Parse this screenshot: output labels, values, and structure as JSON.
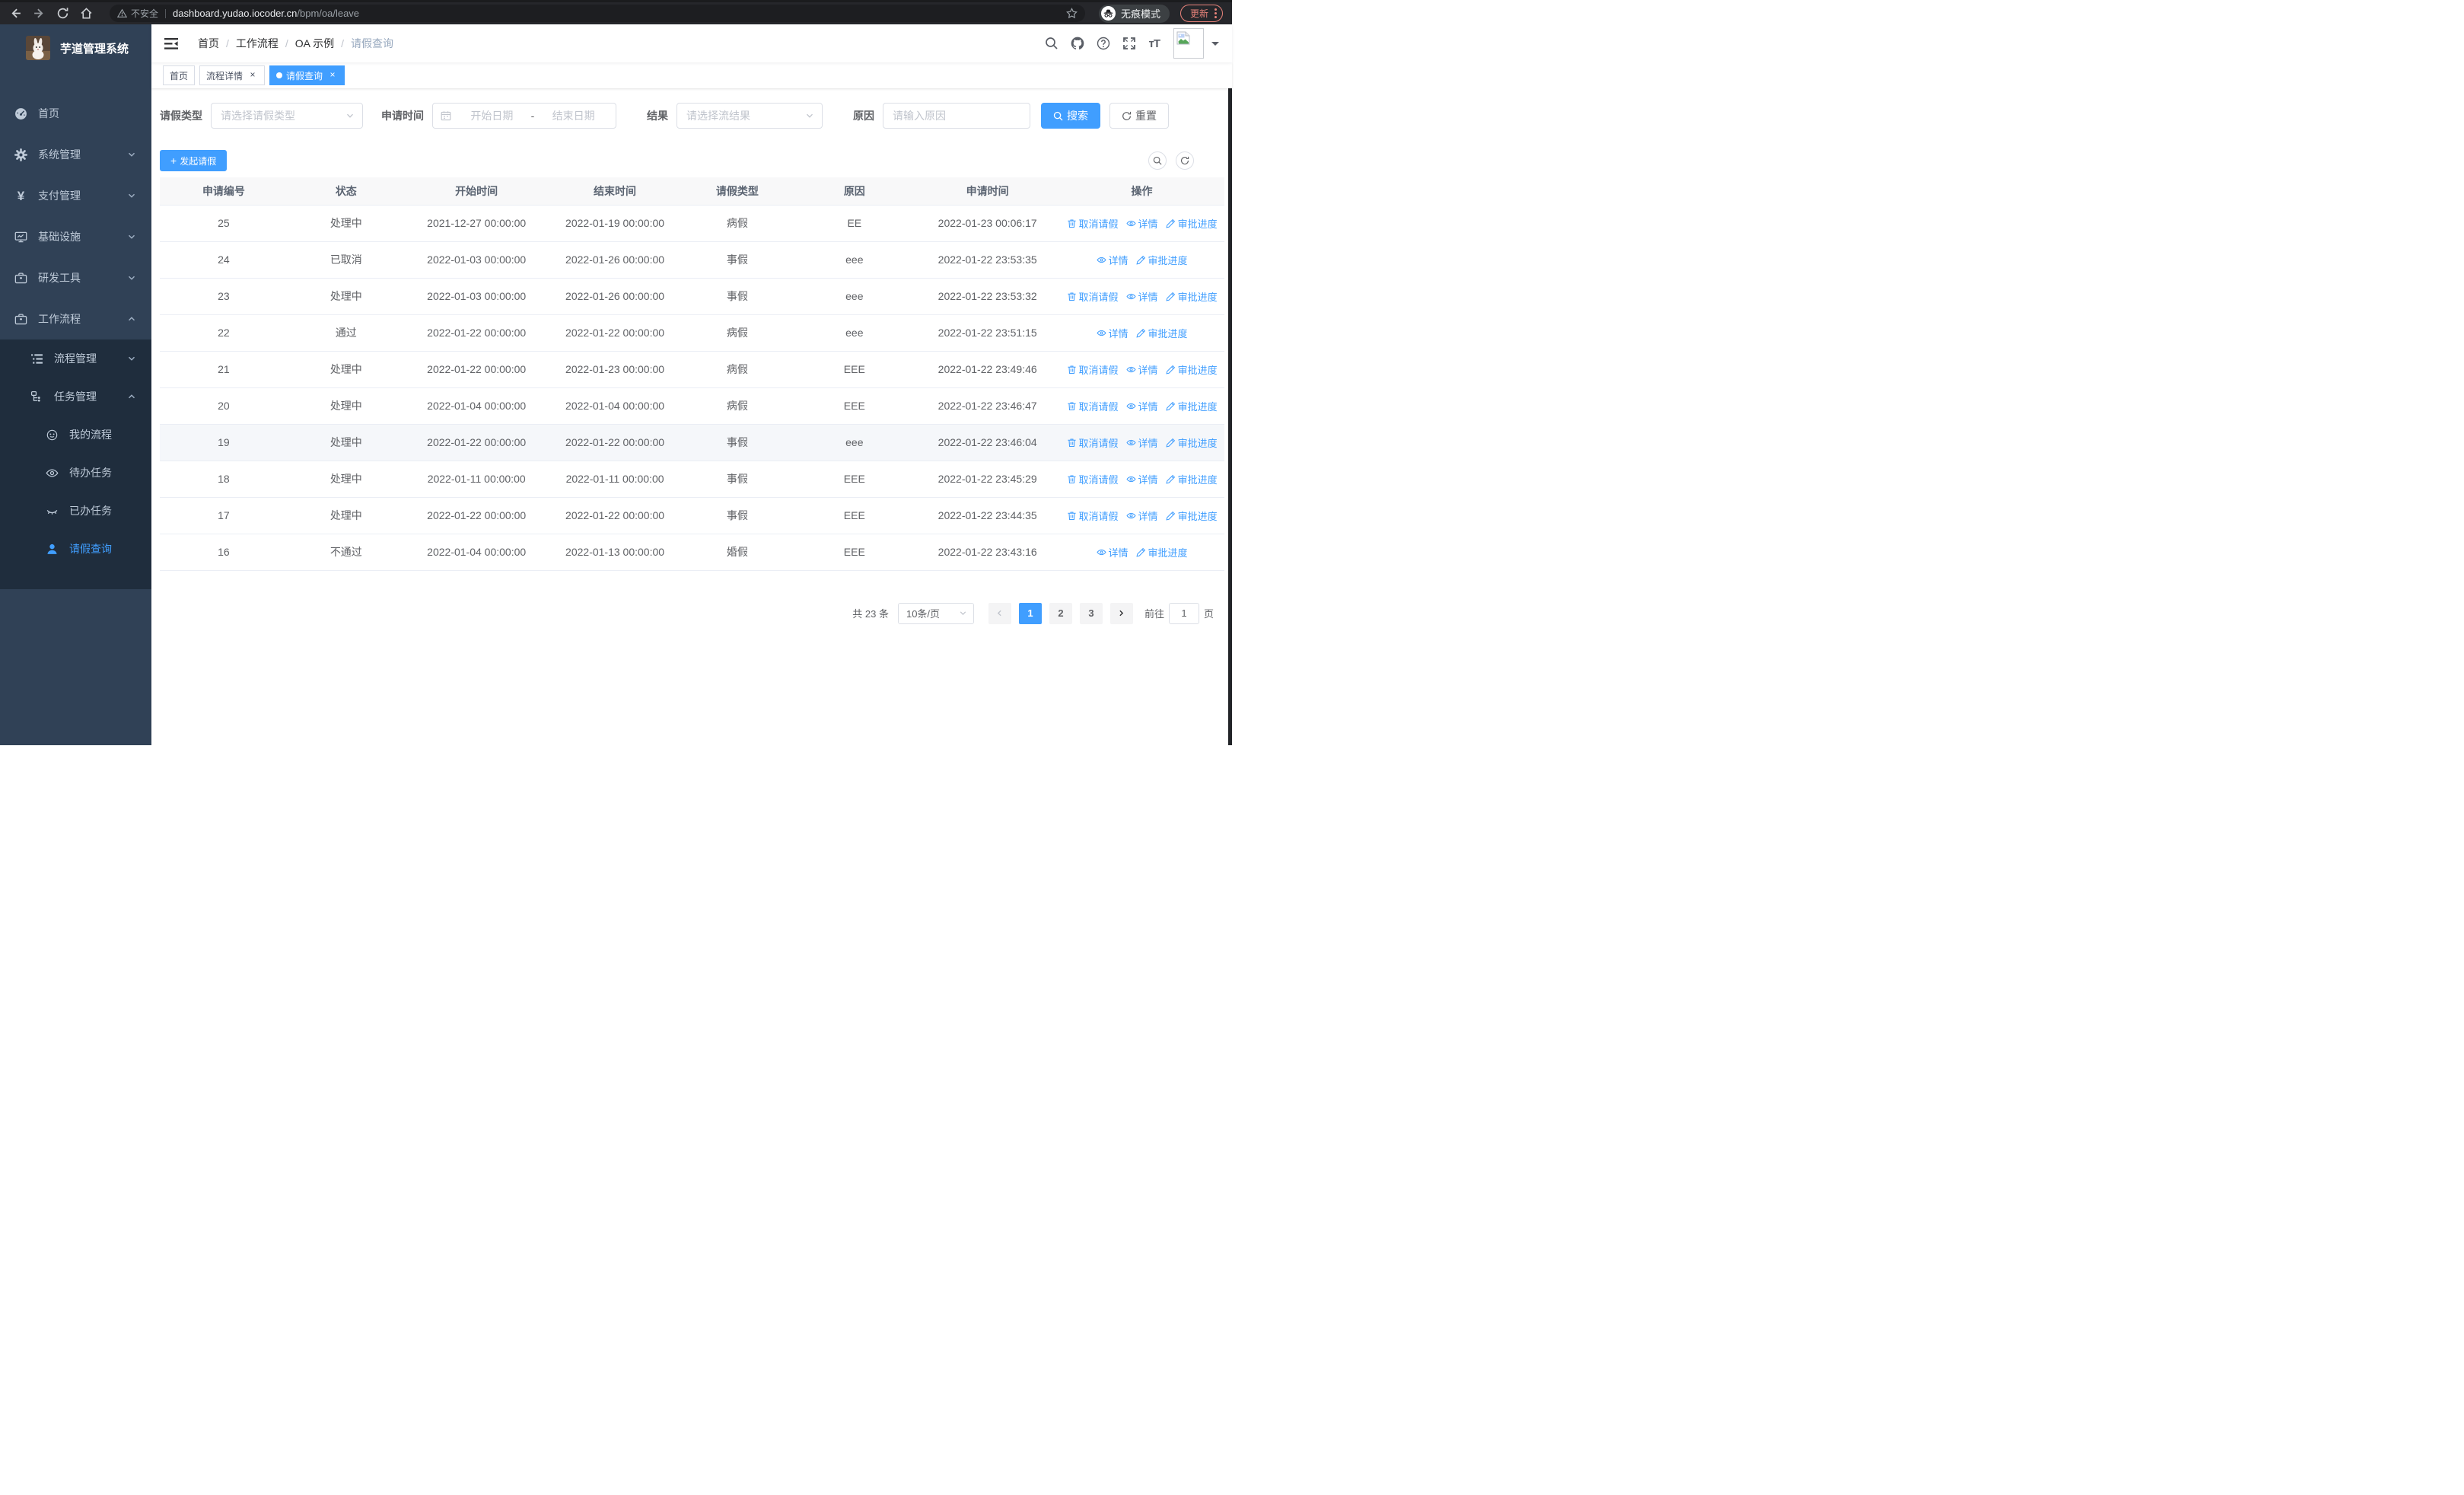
{
  "browser": {
    "security_label": "不安全",
    "url_domain": "dashboard.yudao.iocoder.cn",
    "url_path": "/bpm/oa/leave",
    "incognito_label": "无痕模式",
    "update_label": "更新"
  },
  "sidebar": {
    "logo_title": "芋道管理系统",
    "items": [
      {
        "label": "首页"
      },
      {
        "label": "系统管理"
      },
      {
        "label": "支付管理"
      },
      {
        "label": "基础设施"
      },
      {
        "label": "研发工具"
      },
      {
        "label": "工作流程"
      }
    ],
    "workflow_children": [
      {
        "label": "流程管理"
      },
      {
        "label": "任务管理"
      }
    ],
    "task_children": [
      {
        "label": "我的流程"
      },
      {
        "label": "待办任务"
      },
      {
        "label": "已办任务"
      },
      {
        "label": "请假查询"
      }
    ]
  },
  "navbar": {
    "breadcrumb": [
      "首页",
      "工作流程",
      "OA 示例",
      "请假查询"
    ]
  },
  "tabs": [
    {
      "label": "首页"
    },
    {
      "label": "流程详情"
    },
    {
      "label": "请假查询"
    }
  ],
  "filters": {
    "leave_type_label": "请假类型",
    "leave_type_placeholder": "请选择请假类型",
    "apply_time_label": "申请时间",
    "date_start_placeholder": "开始日期",
    "date_separator": "-",
    "date_end_placeholder": "结束日期",
    "result_label": "结果",
    "result_placeholder": "请选择流结果",
    "reason_label": "原因",
    "reason_placeholder": "请输入原因",
    "search_label": "搜索",
    "reset_label": "重置"
  },
  "toolbar": {
    "create_label": "发起请假"
  },
  "table": {
    "headers": [
      "申请编号",
      "状态",
      "开始时间",
      "结束时间",
      "请假类型",
      "原因",
      "申请时间",
      "操作"
    ],
    "action_labels": {
      "cancel": "取消请假",
      "detail": "详情",
      "progress": "审批进度"
    },
    "rows": [
      {
        "id": "25",
        "status": "处理中",
        "start_time": "2021-12-27 00:00:00",
        "end_time": "2022-01-19 00:00:00",
        "leave_type": "病假",
        "reason": "EE",
        "apply_time": "2022-01-23 00:06:17",
        "actions": [
          "cancel",
          "detail",
          "progress"
        ],
        "highlight": false
      },
      {
        "id": "24",
        "status": "已取消",
        "start_time": "2022-01-03 00:00:00",
        "end_time": "2022-01-26 00:00:00",
        "leave_type": "事假",
        "reason": "eee",
        "apply_time": "2022-01-22 23:53:35",
        "actions": [
          "detail",
          "progress"
        ],
        "highlight": false
      },
      {
        "id": "23",
        "status": "处理中",
        "start_time": "2022-01-03 00:00:00",
        "end_time": "2022-01-26 00:00:00",
        "leave_type": "事假",
        "reason": "eee",
        "apply_time": "2022-01-22 23:53:32",
        "actions": [
          "cancel",
          "detail",
          "progress"
        ],
        "highlight": false
      },
      {
        "id": "22",
        "status": "通过",
        "start_time": "2022-01-22 00:00:00",
        "end_time": "2022-01-22 00:00:00",
        "leave_type": "病假",
        "reason": "eee",
        "apply_time": "2022-01-22 23:51:15",
        "actions": [
          "detail",
          "progress"
        ],
        "highlight": false
      },
      {
        "id": "21",
        "status": "处理中",
        "start_time": "2022-01-22 00:00:00",
        "end_time": "2022-01-23 00:00:00",
        "leave_type": "病假",
        "reason": "EEE",
        "apply_time": "2022-01-22 23:49:46",
        "actions": [
          "cancel",
          "detail",
          "progress"
        ],
        "highlight": false
      },
      {
        "id": "20",
        "status": "处理中",
        "start_time": "2022-01-04 00:00:00",
        "end_time": "2022-01-04 00:00:00",
        "leave_type": "病假",
        "reason": "EEE",
        "apply_time": "2022-01-22 23:46:47",
        "actions": [
          "cancel",
          "detail",
          "progress"
        ],
        "highlight": false
      },
      {
        "id": "19",
        "status": "处理中",
        "start_time": "2022-01-22 00:00:00",
        "end_time": "2022-01-22 00:00:00",
        "leave_type": "事假",
        "reason": "eee",
        "apply_time": "2022-01-22 23:46:04",
        "actions": [
          "cancel",
          "detail",
          "progress"
        ],
        "highlight": true
      },
      {
        "id": "18",
        "status": "处理中",
        "start_time": "2022-01-11 00:00:00",
        "end_time": "2022-01-11 00:00:00",
        "leave_type": "事假",
        "reason": "EEE",
        "apply_time": "2022-01-22 23:45:29",
        "actions": [
          "cancel",
          "detail",
          "progress"
        ],
        "highlight": false
      },
      {
        "id": "17",
        "status": "处理中",
        "start_time": "2022-01-22 00:00:00",
        "end_time": "2022-01-22 00:00:00",
        "leave_type": "事假",
        "reason": "EEE",
        "apply_time": "2022-01-22 23:44:35",
        "actions": [
          "cancel",
          "detail",
          "progress"
        ],
        "highlight": false
      },
      {
        "id": "16",
        "status": "不通过",
        "start_time": "2022-01-04 00:00:00",
        "end_time": "2022-01-13 00:00:00",
        "leave_type": "婚假",
        "reason": "EEE",
        "apply_time": "2022-01-22 23:43:16",
        "actions": [
          "detail",
          "progress"
        ],
        "highlight": false
      }
    ]
  },
  "pagination": {
    "total_label": "共 23 条",
    "page_size_label": "10条/页",
    "pages": [
      "1",
      "2",
      "3"
    ],
    "active_page": "1",
    "goto_label": "前往",
    "goto_value": "1",
    "goto_suffix_label": "页"
  },
  "colors": {
    "accent": "#409eff",
    "sidebar_bg": "#304156",
    "submenu_bg": "#1f2d3d",
    "sidebar_text": "#bfcbd9",
    "update_badge": "#e8837a",
    "table_header_bg": "#f8f8f9",
    "row_highlight": "#f5f7fa"
  }
}
